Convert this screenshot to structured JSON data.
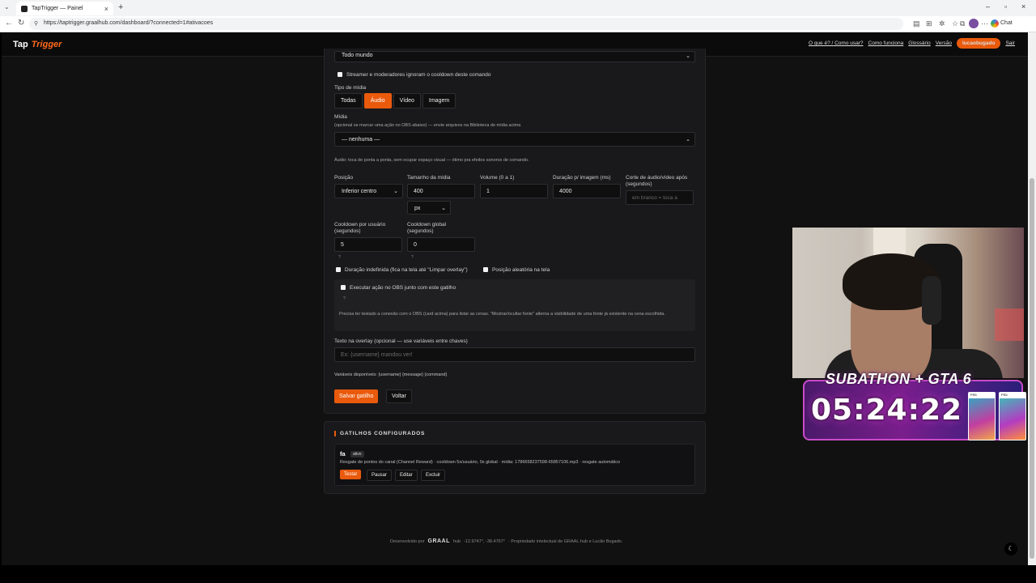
{
  "browser": {
    "tab_title": "TapTrigger — Painel",
    "url": "https://taptrigger.graalhub.com/dashboard/?connected=1#ativacoes",
    "chat_label": "Chat"
  },
  "nav": {
    "logo_a": "Tap",
    "logo_b": "Trigger",
    "links": [
      "O que é? / Como usar?",
      "Como funciona",
      "Glossário",
      "Versão"
    ],
    "user": "lucaobugado",
    "logout": "Sair"
  },
  "form": {
    "audience_value": "Todo mundo",
    "streamer_ignore_label": "Streamer e moderadores ignoram o cooldown deste comando",
    "media_type_label": "Tipo de mídia",
    "media_types": [
      "Todas",
      "Áudio",
      "Vídeo",
      "Imagem"
    ],
    "media_type_selected": "Áudio",
    "media_label": "Mídia",
    "media_hint": "(opcional se marcar uma ação no OBS abaixo) — envie arquivos na Biblioteca de mídia acima",
    "media_value": "— nenhuma —",
    "audio_hint": "Áudio: toca de ponta a ponta, sem ocupar espaço visual — ótimo pra efeitos sonoros de comando.",
    "position_label": "Posição",
    "position_value": "Inferior centro",
    "size_label": "Tamanho da mídia",
    "size_value": "400",
    "size_unit": "px",
    "volume_label": "Volume (0 a 1)",
    "volume_value": "1",
    "duration_label": "Duração p/ imagem (ms)",
    "duration_value": "4000",
    "cut_label": "Corte de áudio/vídeo após (segundos)",
    "cut_placeholder": "em branco = toca a",
    "cooldown_user_label": "Cooldown por usuário (segundos)",
    "cooldown_user_value": "5",
    "cooldown_global_label": "Cooldown global (segundos)",
    "cooldown_global_value": "0",
    "help_mark": "?",
    "indef_label": "Duração indefinida (fica na tela até \"Limpar overlay\")",
    "random_pos_label": "Posição aleatória na tela",
    "obs_label": "Executar ação no OBS junto com este gatilho",
    "obs_hint": "Precisa ter testado a conexão com o OBS (card acima) para listar as cenas. \"Mostrar/ocultar fonte\" alterna a visibilidade de uma fonte já existente na cena escolhida.",
    "overlay_text_label": "Texto na overlay (opcional — use variáveis entre chaves)",
    "overlay_text_placeholder": "Ex: {username} mandou ver!",
    "vars_label": "Variáveis disponíveis: {username} {message} {command}",
    "save_button": "Salvar gatilho",
    "back_button": "Voltar"
  },
  "triggers": {
    "title": "GATILHOS CONFIGURADOS",
    "items": [
      {
        "name": "fa",
        "status": "ativo",
        "desc": "Resgate de pontos do canal (Channel Reward) · cooldown 5s/usuário, 0s global · mídia: 1786658237598-65857106.mp3 · resgate automático",
        "actions": [
          "Testar",
          "Pausar",
          "Editar",
          "Excluir"
        ]
      }
    ]
  },
  "footer": {
    "dev_by": "Desenvolvido por",
    "brand": "GRAAL",
    "brand_suffix": "hub",
    "coords": "-12.9747°, -38.4767°",
    "rights": "· Propriedade intelectual de GRAAL.hub e Lucão Bugado."
  },
  "overlay": {
    "subathon_title": "SUBATHON + GTA 6",
    "timer": "05:24:22",
    "cover_label": "PS5"
  },
  "colors": {
    "accent": "#ea5a0c",
    "background": "#111112",
    "card": "#19191b"
  }
}
